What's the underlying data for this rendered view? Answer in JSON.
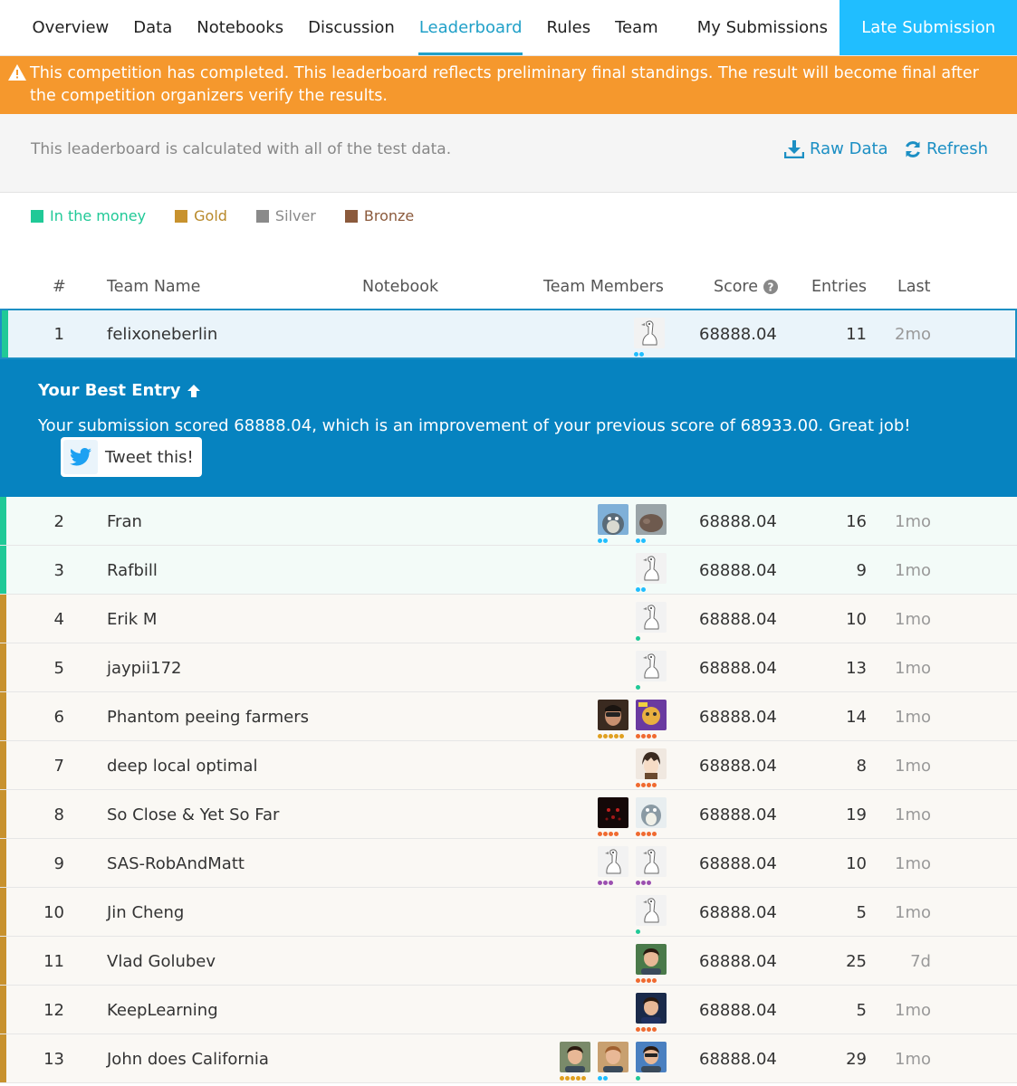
{
  "nav": {
    "items": [
      "Overview",
      "Data",
      "Notebooks",
      "Discussion",
      "Leaderboard",
      "Rules",
      "Team",
      "My Submissions"
    ],
    "active": "Leaderboard",
    "late_submission": "Late Submission"
  },
  "banner": {
    "text": "This competition has completed. This leaderboard reflects preliminary final standings. The result will become final after the competition organizers verify the results."
  },
  "info": {
    "text": "This leaderboard is calculated with all of the test data.",
    "raw_data": "Raw Data",
    "refresh": "Refresh"
  },
  "legend": [
    {
      "label": "In the money",
      "color": "#20c997"
    },
    {
      "label": "Gold",
      "color": "#b8892a"
    },
    {
      "label": "Silver",
      "color": "#8a8a8a"
    },
    {
      "label": "Bronze",
      "color": "#8b5a3c"
    }
  ],
  "columns": {
    "rank": "#",
    "team_name": "Team Name",
    "notebook": "Notebook",
    "team_members": "Team Members",
    "score": "Score",
    "entries": "Entries",
    "last": "Last"
  },
  "best_entry": {
    "title": "Your Best Entry",
    "text": "Your submission scored 68888.04, which is an improvement of your previous score of 68933.00. Great job!",
    "tweet": "Tweet this!"
  },
  "colors": {
    "accent": "#20a0c8",
    "money": "#20c997",
    "gold_bar": "#c8922e",
    "best_bg": "#0683c0",
    "banner": "#f5982d"
  },
  "rows": [
    {
      "rank": "1",
      "team": "felixoneberlin",
      "score": "68888.04",
      "entries": "11",
      "last": "2mo",
      "tier": "first",
      "members": [
        {
          "pic": "goose",
          "dots": [
            "#20beff",
            "#20beff"
          ]
        }
      ]
    },
    {
      "rank": "2",
      "team": "Fran",
      "score": "68888.04",
      "entries": "16",
      "last": "1mo",
      "tier": "money",
      "members": [
        {
          "pic": "totoro",
          "dots": [
            "#20beff",
            "#20beff"
          ]
        },
        {
          "pic": "rock",
          "dots": [
            "#20beff",
            "#20beff"
          ]
        }
      ]
    },
    {
      "rank": "3",
      "team": "Rafbill",
      "score": "68888.04",
      "entries": "9",
      "last": "1mo",
      "tier": "money",
      "members": [
        {
          "pic": "goose",
          "dots": [
            "#20beff",
            "#20beff"
          ]
        }
      ]
    },
    {
      "rank": "4",
      "team": "Erik M",
      "score": "68888.04",
      "entries": "10",
      "last": "1mo",
      "tier": "gold",
      "members": [
        {
          "pic": "goose",
          "dots": [
            "#20c997"
          ]
        }
      ]
    },
    {
      "rank": "5",
      "team": "jaypii172",
      "score": "68888.04",
      "entries": "13",
      "last": "1mo",
      "tier": "gold",
      "members": [
        {
          "pic": "goose",
          "dots": [
            "#20c997"
          ]
        }
      ]
    },
    {
      "rank": "6",
      "team": "Phantom peeing farmers",
      "score": "68888.04",
      "entries": "14",
      "last": "1mo",
      "tier": "gold",
      "members": [
        {
          "pic": "face",
          "dots": [
            "#e0a020",
            "#e0a020",
            "#e0a020",
            "#e0a020",
            "#e0a020"
          ]
        },
        {
          "pic": "purple",
          "dots": [
            "#f06a30",
            "#f06a30",
            "#f06a30",
            "#f06a30"
          ]
        }
      ]
    },
    {
      "rank": "7",
      "team": "deep local optimal",
      "score": "68888.04",
      "entries": "8",
      "last": "1mo",
      "tier": "gold",
      "members": [
        {
          "pic": "anime",
          "dots": [
            "#f06a30",
            "#f06a30",
            "#f06a30",
            "#f06a30"
          ]
        }
      ]
    },
    {
      "rank": "8",
      "team": "So Close & Yet So Far",
      "score": "68888.04",
      "entries": "19",
      "last": "1mo",
      "tier": "gold",
      "members": [
        {
          "pic": "dark",
          "dots": [
            "#f06a30",
            "#f06a30",
            "#f06a30",
            "#f06a30"
          ]
        },
        {
          "pic": "totoro2",
          "dots": [
            "#f06a30",
            "#f06a30",
            "#f06a30",
            "#f06a30"
          ]
        }
      ]
    },
    {
      "rank": "9",
      "team": "SAS-RobAndMatt",
      "score": "68888.04",
      "entries": "10",
      "last": "1mo",
      "tier": "gold",
      "members": [
        {
          "pic": "goose",
          "dots": [
            "#9b4fb0",
            "#9b4fb0",
            "#9b4fb0"
          ]
        },
        {
          "pic": "goose",
          "dots": [
            "#9b4fb0",
            "#9b4fb0",
            "#9b4fb0"
          ]
        }
      ]
    },
    {
      "rank": "10",
      "team": "Jin Cheng",
      "score": "68888.04",
      "entries": "5",
      "last": "1mo",
      "tier": "gold",
      "members": [
        {
          "pic": "goose",
          "dots": [
            "#20c997"
          ]
        }
      ]
    },
    {
      "rank": "11",
      "team": "Vlad Golubev",
      "score": "68888.04",
      "entries": "25",
      "last": "7d",
      "tier": "gold",
      "members": [
        {
          "pic": "man1",
          "dots": [
            "#f06a30",
            "#f06a30",
            "#f06a30",
            "#f06a30"
          ]
        }
      ]
    },
    {
      "rank": "12",
      "team": "KeepLearning",
      "score": "68888.04",
      "entries": "5",
      "last": "1mo",
      "tier": "gold",
      "members": [
        {
          "pic": "man2",
          "dots": [
            "#f06a30",
            "#f06a30",
            "#f06a30",
            "#f06a30"
          ]
        }
      ]
    },
    {
      "rank": "13",
      "team": "John does California",
      "score": "68888.04",
      "entries": "29",
      "last": "1mo",
      "tier": "gold",
      "members": [
        {
          "pic": "man3",
          "dots": [
            "#e0a020",
            "#e0a020",
            "#e0a020",
            "#e0a020",
            "#e0a020"
          ]
        },
        {
          "pic": "man4",
          "dots": [
            "#20beff",
            "#20beff"
          ]
        },
        {
          "pic": "man5",
          "dots": [
            "#20c997"
          ]
        }
      ]
    }
  ]
}
